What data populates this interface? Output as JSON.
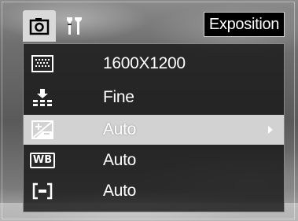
{
  "screen": {
    "title": "Exposition"
  },
  "tabs": [
    {
      "icon": "camera-icon",
      "active": true
    },
    {
      "icon": "wrench-icon",
      "active": false
    }
  ],
  "menu": {
    "items": [
      {
        "icon": "resolution-icon",
        "value": "1600X1200",
        "selected": false
      },
      {
        "icon": "quality-icon",
        "value": "Fine",
        "selected": false
      },
      {
        "icon": "exposure-compensation-icon",
        "value": "Auto",
        "selected": true
      },
      {
        "icon": "white-balance-icon",
        "wb_text": "WB",
        "value": "Auto",
        "selected": false
      },
      {
        "icon": "metering-icon",
        "value": "Auto",
        "selected": false
      }
    ]
  },
  "colors": {
    "selected_row": "#d2d2d2",
    "panel": "#191919",
    "text": "#ffffff"
  }
}
